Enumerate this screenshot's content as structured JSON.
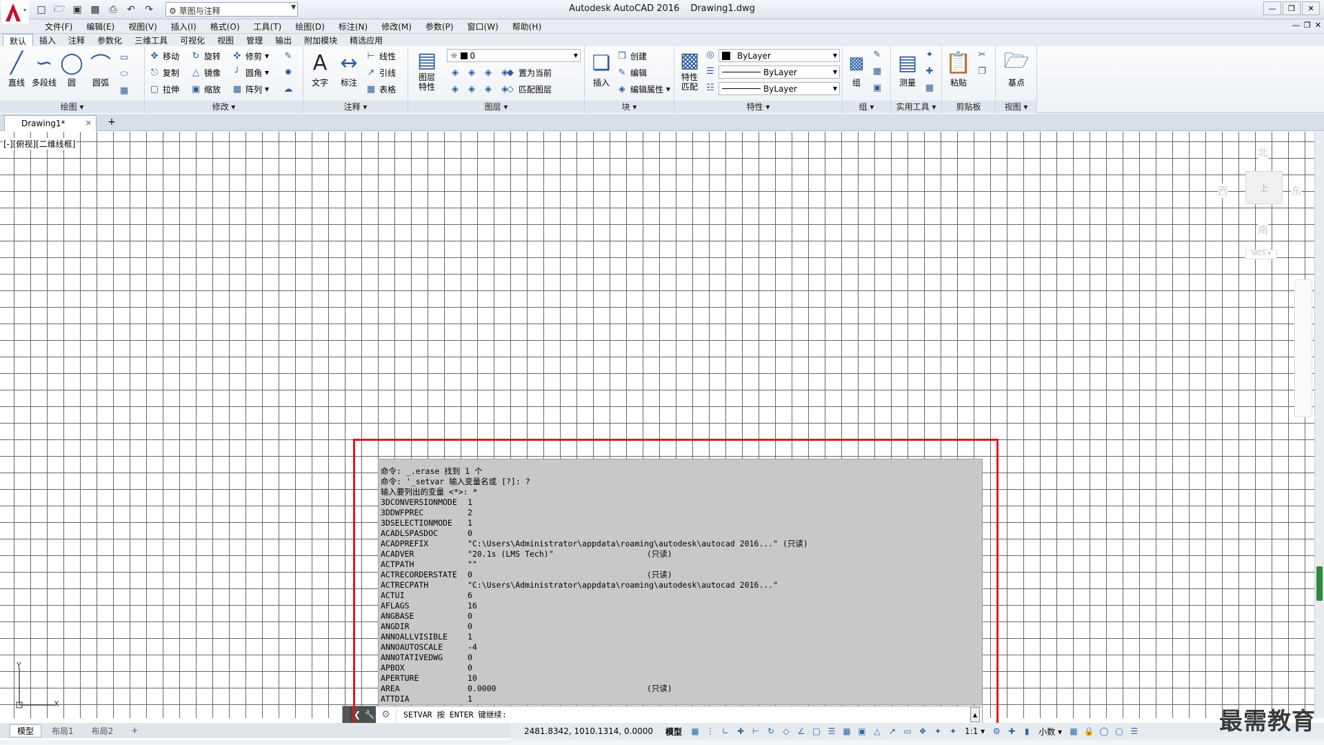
{
  "title": {
    "app": "Autodesk AutoCAD 2016",
    "file": "Drawing1.dwg"
  },
  "workspace": "草图与注释",
  "menu": [
    "文件(F)",
    "编辑(E)",
    "视图(V)",
    "插入(I)",
    "格式(O)",
    "工具(T)",
    "绘图(D)",
    "标注(N)",
    "修改(M)",
    "参数(P)",
    "窗口(W)",
    "帮助(H)"
  ],
  "ribbon_tabs": [
    "默认",
    "插入",
    "注释",
    "参数化",
    "三维工具",
    "可视化",
    "视图",
    "管理",
    "输出",
    "附加模块",
    "精选应用"
  ],
  "panels": {
    "draw": {
      "title": "绘图",
      "line": "直线",
      "polyline": "多段线",
      "circle": "圆",
      "arc": "圆弧"
    },
    "modify": {
      "title": "修改",
      "move": "移动",
      "rotate": "旋转",
      "trim": "修剪",
      "copy": "复制",
      "mirror": "镜像",
      "fillet": "圆角",
      "stretch": "拉伸",
      "scale": "缩放",
      "array": "阵列"
    },
    "annotation": {
      "title": "注释",
      "text": "文字",
      "dimension": "标注",
      "linear": "线性",
      "leader": "引线",
      "table": "表格"
    },
    "layers": {
      "title": "图层",
      "props": "图层\n特性",
      "current_layer": "0",
      "make_current": "置为当前",
      "match": "匹配图层"
    },
    "block": {
      "title": "块",
      "insert": "插入",
      "create": "创建",
      "edit": "编辑",
      "edit_attr": "编辑属性"
    },
    "properties": {
      "title": "特性",
      "match": "特性\n匹配",
      "color": "ByLayer",
      "linetype": "ByLayer",
      "lineweight": "ByLayer"
    },
    "groups": {
      "title": "组",
      "group": "组"
    },
    "utilities": {
      "title": "实用工具",
      "measure": "测量"
    },
    "clipboard": {
      "title": "剪贴板",
      "paste": "粘贴"
    },
    "view": {
      "title": "视图",
      "base": "基点"
    }
  },
  "doc_tab": "Drawing1*",
  "viewport_label": "[-][俯视][二维线框]",
  "viewcube": {
    "north": "北",
    "south": "南",
    "east": "东",
    "west": "西",
    "face": "上",
    "wcs": "WCS"
  },
  "command_history": [
    "命令: _.erase 找到 1 个",
    "命令: '_setvar 输入变量名或 [?]: ?",
    "输入要列出的变量 <*>: *"
  ],
  "variables": [
    {
      "name": "3DCONVERSIONMODE",
      "value": "1",
      "note": ""
    },
    {
      "name": "3DDWFPREC",
      "value": "2",
      "note": ""
    },
    {
      "name": "3DSELECTIONMODE",
      "value": "1",
      "note": ""
    },
    {
      "name": "ACADLSPASDOC",
      "value": "0",
      "note": ""
    },
    {
      "name": "ACADPREFIX",
      "value": "\"C:\\Users\\Administrator\\appdata\\roaming\\autodesk\\autocad 2016...\" (只读)",
      "note": ""
    },
    {
      "name": "ACADVER",
      "value": "\"20.1s (LMS Tech)\"",
      "note": "(只读)"
    },
    {
      "name": "ACTPATH",
      "value": "\"\"",
      "note": ""
    },
    {
      "name": "ACTRECORDERSTATE",
      "value": "0",
      "note": "(只读)"
    },
    {
      "name": "ACTRECPATH",
      "value": "\"C:\\Users\\Administrator\\appdata\\roaming\\autodesk\\autocad 2016...\"",
      "note": ""
    },
    {
      "name": "ACTUI",
      "value": "6",
      "note": ""
    },
    {
      "name": "AFLAGS",
      "value": "16",
      "note": ""
    },
    {
      "name": "ANGBASE",
      "value": "0",
      "note": ""
    },
    {
      "name": "ANGDIR",
      "value": "0",
      "note": ""
    },
    {
      "name": "ANNOALLVISIBLE",
      "value": "1",
      "note": ""
    },
    {
      "name": "ANNOAUTOSCALE",
      "value": "-4",
      "note": ""
    },
    {
      "name": "ANNOTATIVEDWG",
      "value": "0",
      "note": ""
    },
    {
      "name": "APBOX",
      "value": "0",
      "note": ""
    },
    {
      "name": "APERTURE",
      "value": "10",
      "note": ""
    },
    {
      "name": "AREA",
      "value": "0.0000",
      "note": "(只读)"
    },
    {
      "name": "ATTDIA",
      "value": "1",
      "note": ""
    }
  ],
  "command_prompt": "SETVAR 按 ENTER 键继续:",
  "layout_tabs": [
    "模型",
    "布局1",
    "布局2"
  ],
  "status": {
    "coords": "2481.8342, 1010.1314, 0.0000",
    "model": "模型",
    "scale": "1:1",
    "units": "小数"
  },
  "watermark": "最需教育",
  "colors": {
    "highlight": "#e5151b",
    "grid": "#666666",
    "history_bg": "#c8c8c8"
  }
}
